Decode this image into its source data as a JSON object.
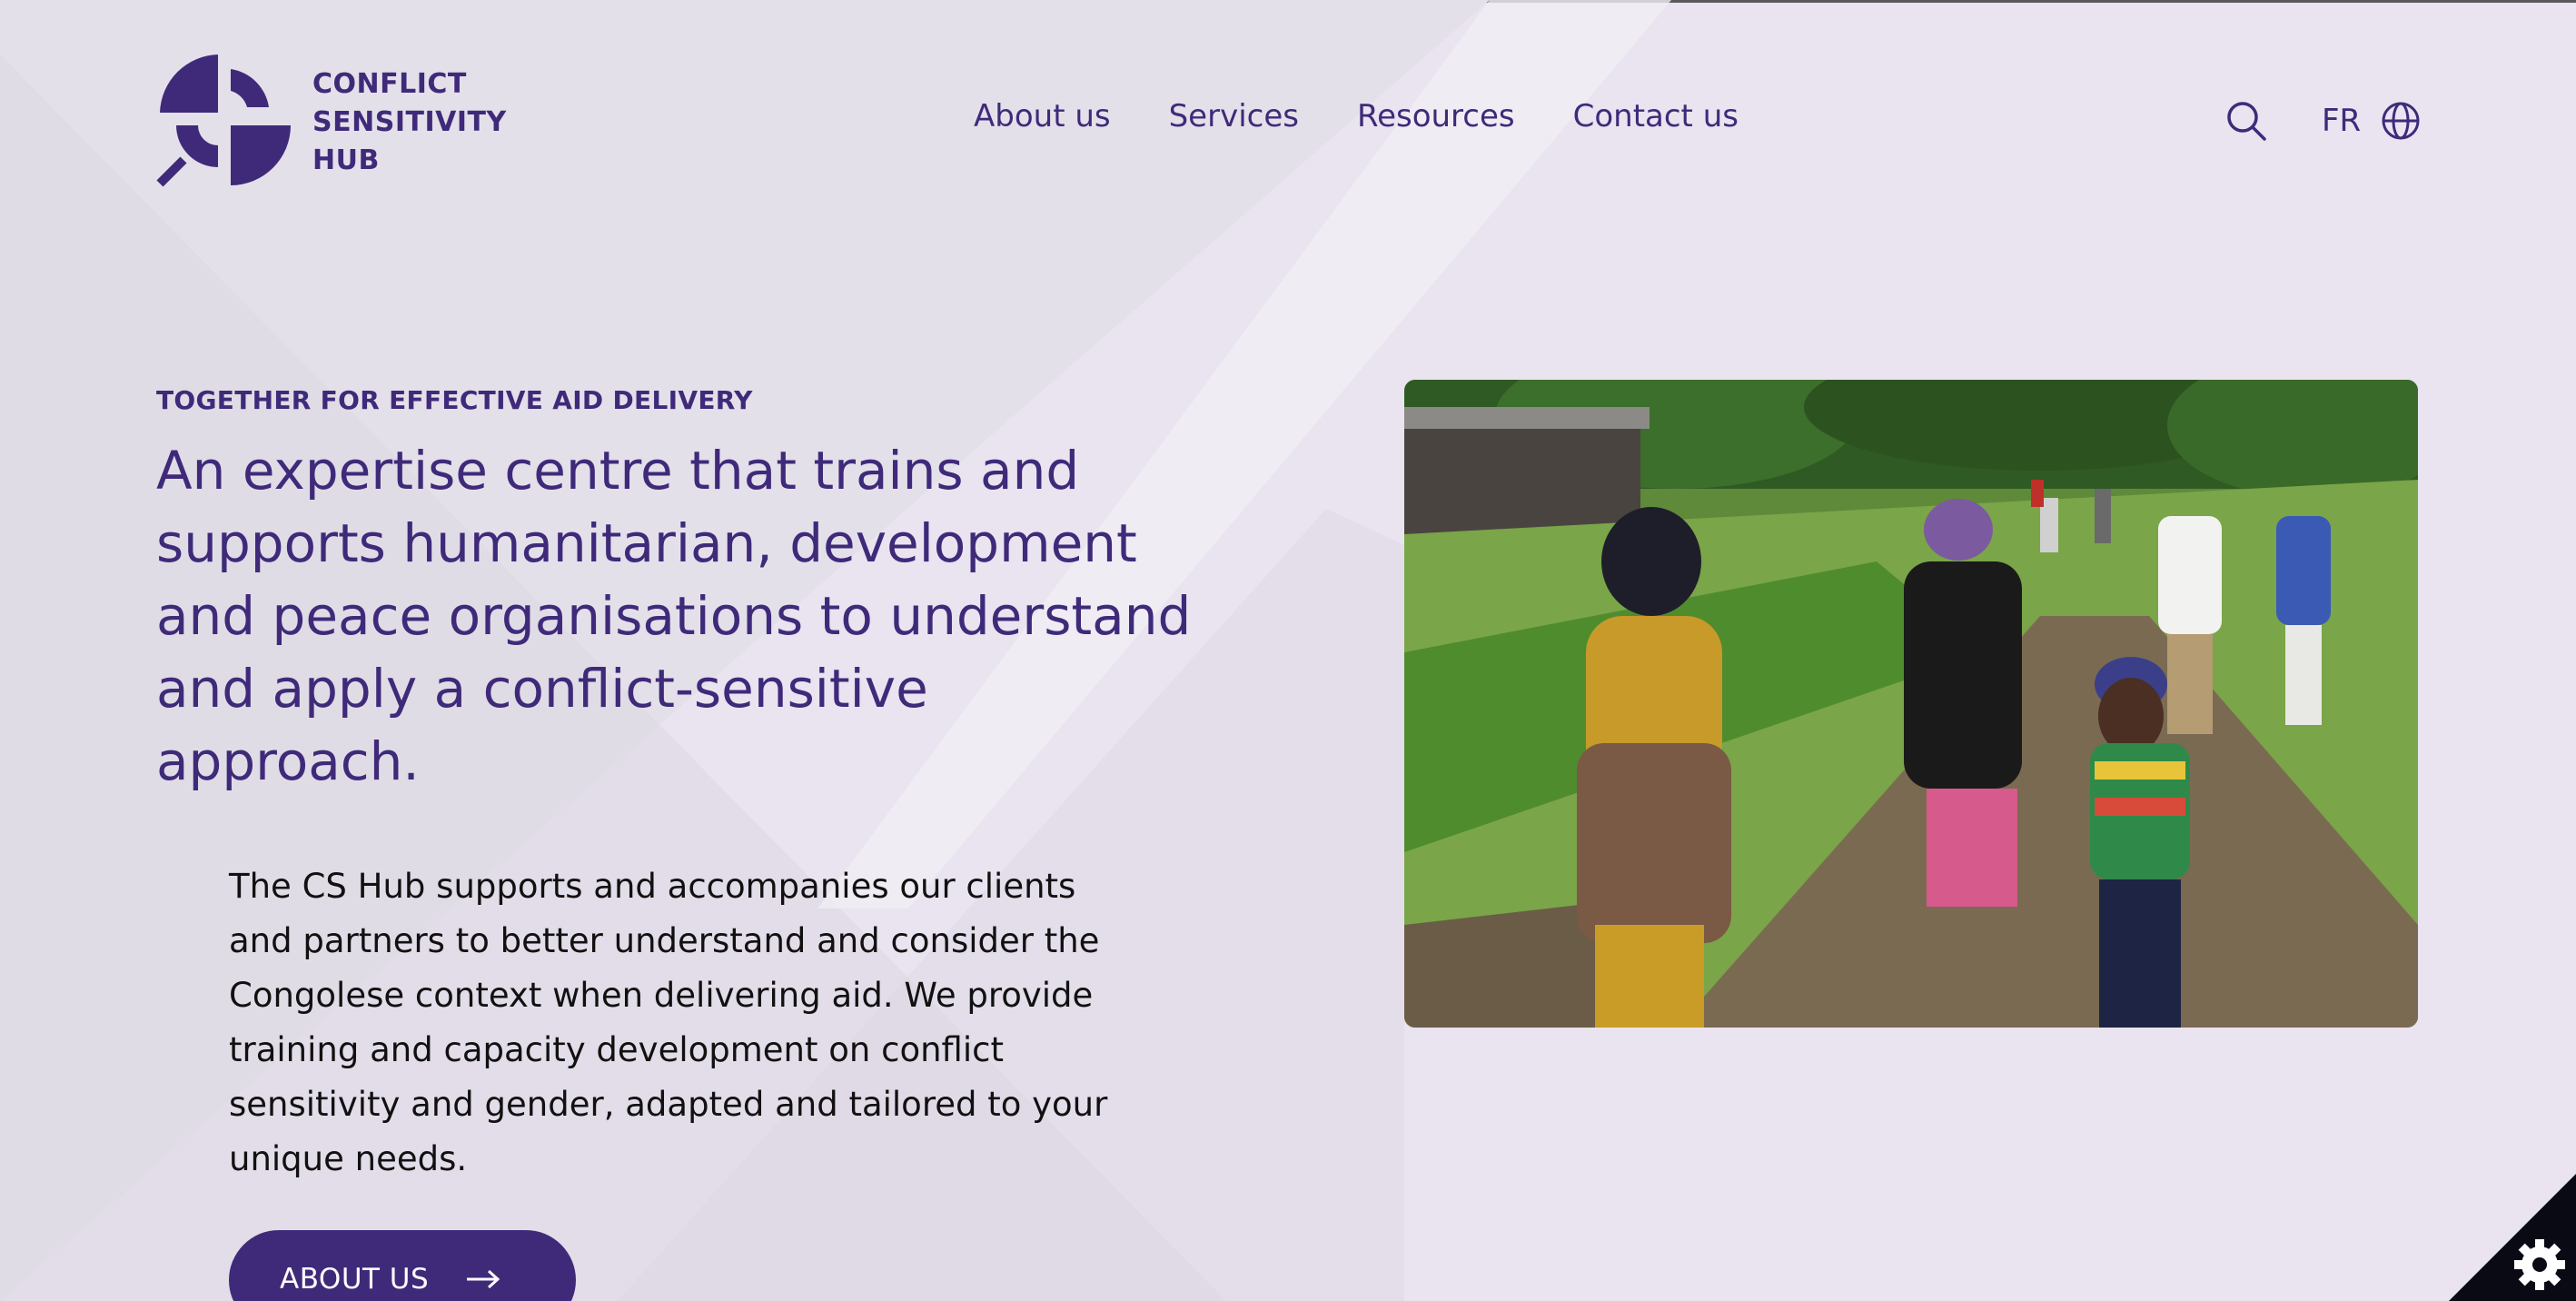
{
  "brand": {
    "name_lines": [
      "CONFLICT",
      "SENSITIVITY",
      "HUB"
    ],
    "logo_icon": "conflict-sensitivity-hub-logo",
    "primary_color": "#3f2a7a",
    "background_color": "#e9e4f0"
  },
  "nav": {
    "items": [
      {
        "label": "About us"
      },
      {
        "label": "Services"
      },
      {
        "label": "Resources"
      },
      {
        "label": "Contact us"
      }
    ]
  },
  "tools": {
    "search_icon": "search-icon",
    "language_label": "FR",
    "language_icon": "globe-icon"
  },
  "hero": {
    "eyebrow": "TOGETHER FOR EFFECTIVE AID DELIVERY",
    "headline": "An expertise centre that trains and supports humanitarian, development and peace organisations to understand and apply a conflict-sensitive approach.",
    "body": "The CS Hub supports and accompanies our clients and partners to better understand and consider the Congolese context when delivering aid. We provide training and capacity development on conflict sensitivity and gender, adapted and tailored to your unique needs.",
    "cta_label": "ABOUT US",
    "cta_icon": "arrow-right-icon",
    "photo_icon": "hero-photo"
  },
  "cookie": {
    "icon": "cookie-settings-gear-icon"
  }
}
